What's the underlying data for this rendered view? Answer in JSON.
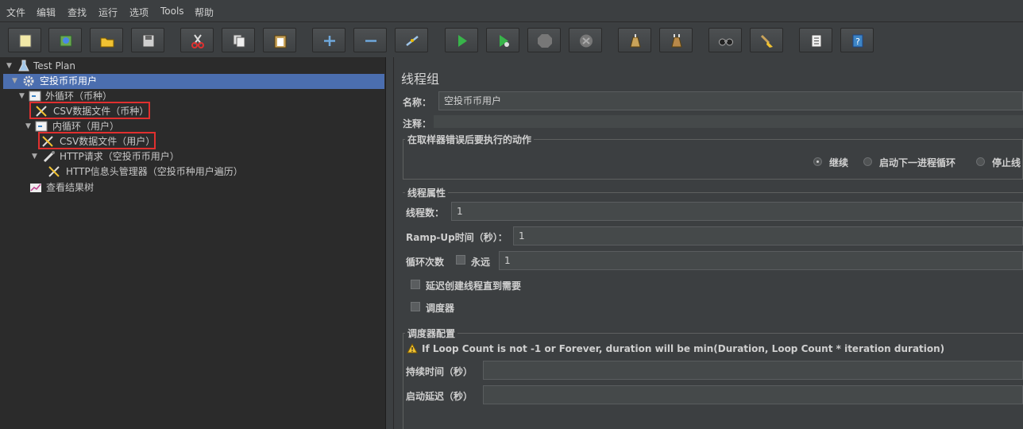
{
  "menu": [
    "文件",
    "编辑",
    "查找",
    "运行",
    "选项",
    "Tools",
    "帮助"
  ],
  "toolbar": {
    "buttons": [
      "new-icon",
      "templates-icon",
      "open-icon",
      "save-icon",
      "cut-icon",
      "copy-icon",
      "paste-icon",
      "expand-icon",
      "collapse-icon",
      "toggle-icon",
      "start-icon",
      "start-no-pause-icon",
      "stop-icon",
      "shutdown-icon",
      "clear-icon",
      "clear-all-icon",
      "search-icon",
      "reset-search-icon",
      "function-helper-icon",
      "help-icon"
    ]
  },
  "tree": {
    "test_plan": "Test Plan",
    "thread_group": "空投币币用户",
    "outer_loop": "外循环（币种）",
    "csv_coin": "CSV数据文件（币种）",
    "inner_loop": "内循环（用户）",
    "csv_user": "CSV数据文件（用户）",
    "http_request": "HTTP请求（空投币币用户）",
    "header_manager": "HTTP信息头管理器（空投币种用户遍历）",
    "result_tree": "查看结果树"
  },
  "panel": {
    "title": "线程组",
    "name_label": "名称：",
    "name_value": "空投币币用户",
    "comment_label": "注释：",
    "comment_value": "",
    "error_group_title": "在取样器错误后要执行的动作",
    "error_options": [
      "继续",
      "启动下一进程循环",
      "停止线"
    ],
    "error_selected": "继续",
    "props_title": "线程属性",
    "threads_label": "线程数：",
    "threads_value": "1",
    "rampup_label": "Ramp-Up时间（秒）：",
    "rampup_value": "1",
    "loop_label": "循环次数",
    "forever_label": "永远",
    "loop_value": "1",
    "delay_label": "延迟创建线程直到需要",
    "scheduler_label": "调度器",
    "sched_config_title": "调度器配置",
    "warning": "If Loop Count is not -1 or Forever, duration will be min(Duration, Loop Count * iteration duration)",
    "duration_label": "持续时间（秒）",
    "duration_value": "",
    "startup_delay_label": "启动延迟（秒）",
    "startup_delay_value": ""
  },
  "colors": {
    "selection": "#4b6eaf",
    "highlight_box": "#e0302f",
    "panel_bg": "#3c3f41",
    "tree_bg": "#2b2b2b"
  }
}
